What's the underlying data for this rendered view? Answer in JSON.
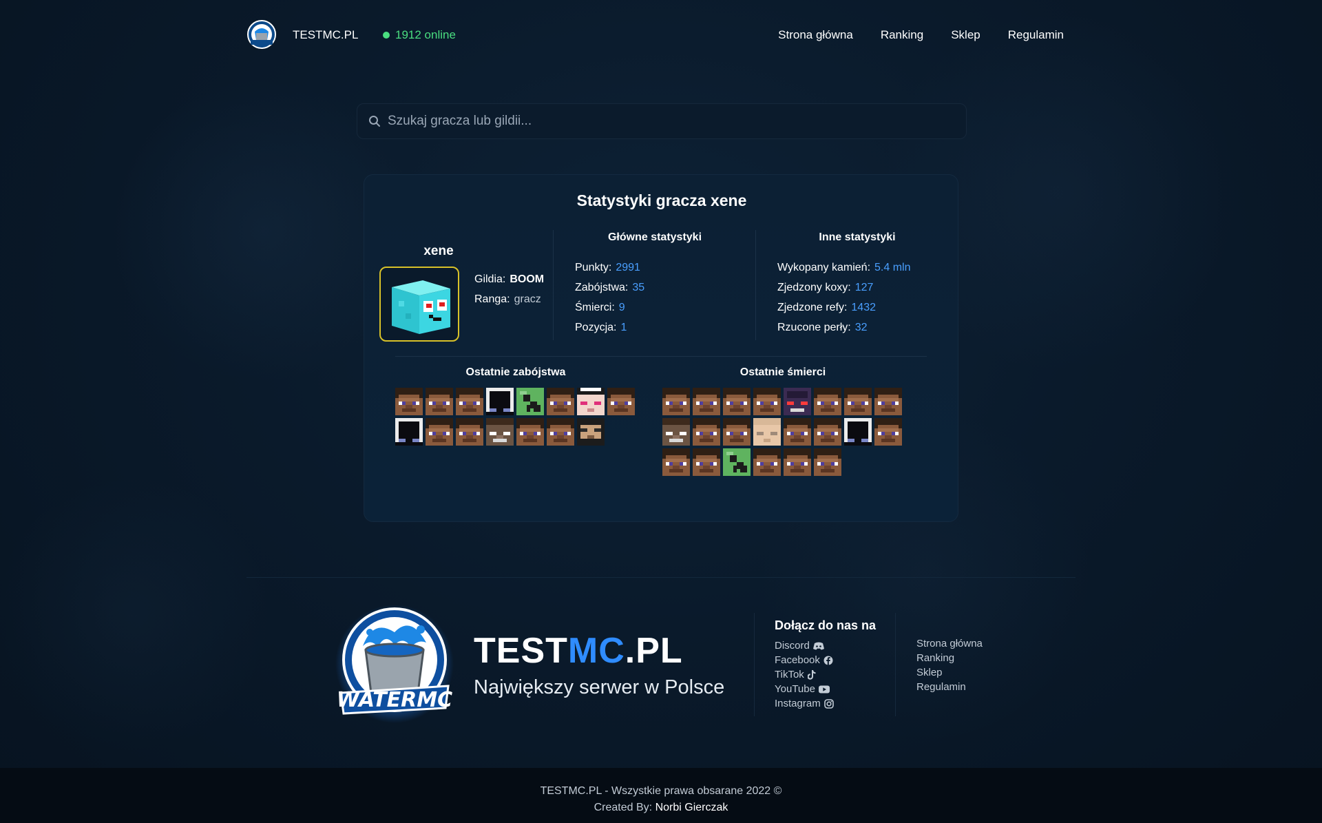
{
  "header": {
    "brand": "TESTMC.PL",
    "online": "1912 online",
    "nav": [
      "Strona główna",
      "Ranking",
      "Sklep",
      "Regulamin"
    ]
  },
  "search": {
    "placeholder": "Szukaj gracza lub gildii..."
  },
  "card": {
    "title": "Statystyki gracza xene",
    "player": "xene",
    "guild_label": "Gildia:",
    "guild_value": "BOOM",
    "rank_label": "Ranga:",
    "rank_value": "gracz",
    "main_title": "Główne statystyki",
    "main_stats": [
      {
        "label": "Punkty:",
        "value": "2991"
      },
      {
        "label": "Zabójstwa:",
        "value": "35"
      },
      {
        "label": "Śmierci:",
        "value": "9"
      },
      {
        "label": "Pozycja:",
        "value": "1"
      }
    ],
    "other_title": "Inne statystyki",
    "other_stats": [
      {
        "label": "Wykopany kamień:",
        "value": "5.4 mln"
      },
      {
        "label": "Zjedzony koxy:",
        "value": "127"
      },
      {
        "label": "Zjedzone refy:",
        "value": "1432"
      },
      {
        "label": "Rzucone perły:",
        "value": "32"
      }
    ],
    "kills_title": "Ostatnie zabójstwa",
    "deaths_title": "Ostatnie śmierci",
    "kills_heads": [
      "steve",
      "steve",
      "steve",
      "dark",
      "creeper",
      "steve",
      "pink",
      "steve",
      "dark",
      "steve",
      "steve",
      "skeleton",
      "steve",
      "steve",
      "suit"
    ],
    "deaths_heads": [
      "steve",
      "steve",
      "steve",
      "steve",
      "purple",
      "steve",
      "steve",
      "steve",
      "skeleton",
      "steve",
      "steve",
      "pale",
      "steve",
      "steve",
      "dark",
      "steve",
      "steve",
      "steve",
      "creeper",
      "steve",
      "steve",
      "steve"
    ]
  },
  "footer": {
    "brand_a": "TEST",
    "brand_b": "MC",
    "brand_c": ".PL",
    "tagline": "Największy serwer w Polsce",
    "join_title": "Dołącz do nas na",
    "socials": [
      {
        "label": "Discord",
        "icon": "discord-icon"
      },
      {
        "label": "Facebook",
        "icon": "facebook-icon"
      },
      {
        "label": "TikTok",
        "icon": "tiktok-icon"
      },
      {
        "label": "YouTube",
        "icon": "youtube-icon"
      },
      {
        "label": "Instagram",
        "icon": "instagram-icon"
      }
    ],
    "links": [
      "Strona główna",
      "Ranking",
      "Sklep",
      "Regulamin"
    ],
    "copyright": "TESTMC.PL - Wszystkie prawa obsarane 2022 ©",
    "created_by": "Created By:",
    "author": "Norbi Gierczak",
    "logo_text": "WATERMC"
  },
  "colors": {
    "accent": "#2f8cff",
    "online": "#4ade80",
    "value": "#4a9fff",
    "avatar_border": "#d9c229"
  }
}
